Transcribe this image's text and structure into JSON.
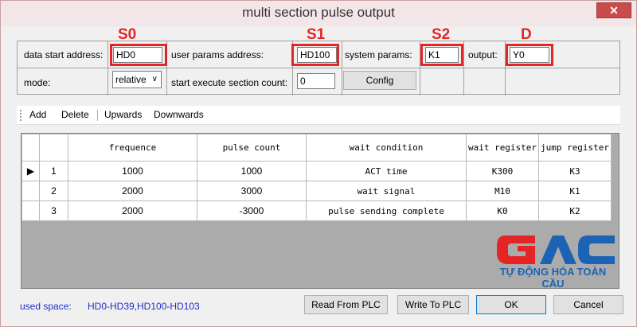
{
  "window": {
    "title": "multi section pulse output",
    "close": "✕"
  },
  "annotations": {
    "s0": "S0",
    "s1": "S1",
    "s2": "S2",
    "d": "D"
  },
  "params": {
    "data_start_label": "data start address:",
    "data_start_value": "HD0",
    "user_params_label": "user params address:",
    "user_params_value": "HD100",
    "system_params_label": "system params:",
    "system_params_value": "K1",
    "output_label": "output:",
    "output_value": "Y0",
    "mode_label": "mode:",
    "mode_value": "relative",
    "start_section_label": "start execute section count:",
    "start_section_value": "0",
    "config_label": "Config"
  },
  "toolbar": {
    "add": "Add",
    "delete": "Delete",
    "upwards": "Upwards",
    "downwards": "Downwards"
  },
  "table": {
    "headers": [
      "frequence",
      "pulse count",
      "wait condition",
      "wait register",
      "jump register"
    ],
    "rows": [
      {
        "marker": "▶",
        "index": "1",
        "frequence": "1000",
        "pulse_count": "1000",
        "wait_condition": "ACT time",
        "wait_register": "K300",
        "jump_register": "K3"
      },
      {
        "marker": "",
        "index": "2",
        "frequence": "2000",
        "pulse_count": "3000",
        "wait_condition": "wait signal",
        "wait_register": "M10",
        "jump_register": "K1"
      },
      {
        "marker": "",
        "index": "3",
        "frequence": "2000",
        "pulse_count": "-3000",
        "wait_condition": "pulse sending complete",
        "wait_register": "K0",
        "jump_register": "K2"
      }
    ]
  },
  "logo": {
    "text": "TỰ ĐỘNG HÓA TOÀN CẦU",
    "colors": {
      "red": "#e52525",
      "blue": "#1c63b5"
    }
  },
  "footer": {
    "used_space_label": "used space:",
    "used_space_value": "HD0-HD39,HD100-HD103",
    "read_button": "Read From PLC",
    "write_button": "Write To PLC",
    "ok_button": "OK",
    "cancel_button": "Cancel"
  }
}
